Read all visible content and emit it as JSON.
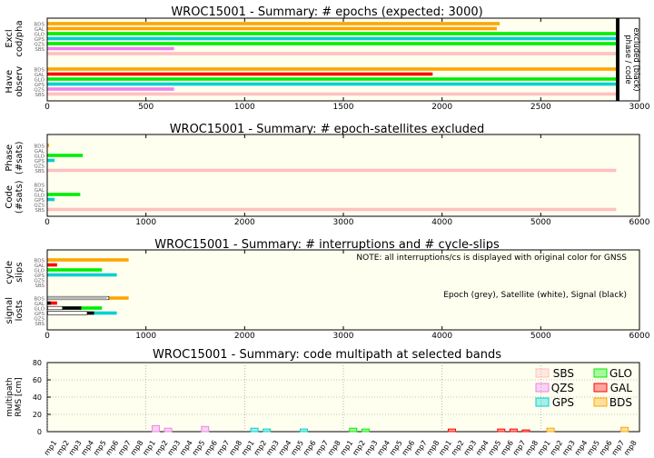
{
  "colors": {
    "plot_bg": "#fffff0",
    "BDS": "#ffa500",
    "GAL": "#ff0000",
    "GLO": "#00ee00",
    "GPS": "#00d0d0",
    "QZS": "#ee82ee",
    "SBS": "#ffc0c0",
    "epoch": "#bbbbbb",
    "satellite": "#ffffff",
    "signal": "#000000",
    "limit": "#000000"
  },
  "chart_data": [
    {
      "type": "bar",
      "orientation": "horizontal",
      "title": "WROC15001 - Summary: # epochs (expected: 3000)",
      "xlim": [
        0,
        3000
      ],
      "xticks": [
        0,
        500,
        1000,
        1500,
        2000,
        2500,
        3000
      ],
      "annotation": [
        "phase / code",
        "excluded (black)"
      ],
      "limit_line_x": 2890,
      "groups": [
        {
          "label": [
            "Excl",
            "cod/pha"
          ],
          "rows": [
            {
              "name": "BDS",
              "values": [
                {
                  "value": 2290,
                  "color": "BDS"
                }
              ]
            },
            {
              "name": "GAL",
              "values": [
                {
                  "value": 2275,
                  "color": "BDS"
                }
              ]
            },
            {
              "name": "GLO",
              "values": [
                {
                  "value": 2880,
                  "color": "GLO"
                }
              ]
            },
            {
              "name": "GPS",
              "values": [
                {
                  "value": 2880,
                  "color": "GPS"
                }
              ]
            },
            {
              "name": "QZS",
              "values": [
                {
                  "value": 2880,
                  "color": "GLO"
                }
              ]
            },
            {
              "name": "SBS",
              "values": [
                {
                  "value": 640,
                  "color": "QZS"
                }
              ]
            },
            {
              "name": "",
              "values": [
                {
                  "value": 2880,
                  "color": "SBS"
                }
              ]
            }
          ]
        },
        {
          "label": [
            "Have",
            "observ"
          ],
          "rows": [
            {
              "name": "BDS",
              "values": [
                {
                  "value": 2880,
                  "color": "BDS"
                }
              ]
            },
            {
              "name": "GAL",
              "values": [
                {
                  "value": 1950,
                  "color": "GAL"
                }
              ]
            },
            {
              "name": "GLO",
              "values": [
                {
                  "value": 2880,
                  "color": "GLO"
                }
              ]
            },
            {
              "name": "GPS",
              "values": [
                {
                  "value": 2880,
                  "color": "GPS"
                }
              ]
            },
            {
              "name": "QZS",
              "values": [
                {
                  "value": 640,
                  "color": "QZS"
                }
              ]
            },
            {
              "name": "SBS",
              "values": [
                {
                  "value": 2880,
                  "color": "SBS"
                }
              ]
            }
          ]
        }
      ]
    },
    {
      "type": "bar",
      "orientation": "horizontal",
      "title": "WROC15001 - Summary: # epoch-satellites excluded",
      "xlim": [
        0,
        6000
      ],
      "xticks": [
        0,
        1000,
        2000,
        3000,
        4000,
        5000,
        6000
      ],
      "groups": [
        {
          "label": [
            "Phase",
            "(#sats)"
          ],
          "rows": [
            {
              "name": "BDS",
              "values": [
                {
                  "value": 15,
                  "color": "BDS"
                }
              ]
            },
            {
              "name": "GAL",
              "values": []
            },
            {
              "name": "GLO",
              "values": [
                {
                  "value": 355,
                  "color": "GLO"
                }
              ]
            },
            {
              "name": "GPS",
              "values": [
                {
                  "value": 70,
                  "color": "GPS"
                }
              ]
            },
            {
              "name": "QZS",
              "values": []
            },
            {
              "name": "SBS",
              "values": [
                {
                  "value": 5760,
                  "color": "SBS"
                }
              ]
            }
          ]
        },
        {
          "label": [
            "Code",
            "(#sats)"
          ],
          "rows": [
            {
              "name": "BDS",
              "values": []
            },
            {
              "name": "GAL",
              "values": []
            },
            {
              "name": "GLO",
              "values": [
                {
                  "value": 330,
                  "color": "GLO"
                }
              ]
            },
            {
              "name": "GPS",
              "values": [
                {
                  "value": 70,
                  "color": "GPS"
                }
              ]
            },
            {
              "name": "QZS",
              "values": []
            },
            {
              "name": "SBS",
              "values": [
                {
                  "value": 5760,
                  "color": "SBS"
                }
              ]
            }
          ]
        }
      ]
    },
    {
      "type": "bar",
      "orientation": "horizontal",
      "title": "WROC15001 - Summary: # interruptions and # cycle-slips",
      "xlim": [
        0,
        6000
      ],
      "xticks": [
        0,
        1000,
        2000,
        3000,
        4000,
        5000,
        6000
      ],
      "notes": [
        "NOTE: all interruptions/cs is displayed with original color for GNSS",
        "Epoch (grey), Satellite (white), Signal (black)"
      ],
      "groups": [
        {
          "label": [
            "cycle",
            "slips"
          ],
          "rows": [
            {
              "name": "BDS",
              "values": [
                {
                  "value": 820,
                  "color": "BDS"
                }
              ]
            },
            {
              "name": "GAL",
              "values": [
                {
                  "value": 95,
                  "color": "GAL"
                }
              ]
            },
            {
              "name": "GLO",
              "values": [
                {
                  "value": 550,
                  "color": "GLO"
                }
              ]
            },
            {
              "name": "GPS",
              "values": [
                {
                  "value": 700,
                  "color": "GPS"
                }
              ]
            },
            {
              "name": "QZS",
              "values": []
            },
            {
              "name": "SBS",
              "values": []
            }
          ]
        },
        {
          "label": [
            "signal",
            "losts"
          ],
          "rows": [
            {
              "name": "BDS",
              "values": [
                {
                  "value": 820,
                  "color": "BDS"
                },
                {
                  "value": 620,
                  "color": "satellite",
                  "outline": true
                },
                {
                  "value": 600,
                  "color": "epoch"
                }
              ]
            },
            {
              "name": "GAL",
              "values": [
                {
                  "value": 95,
                  "color": "GAL"
                },
                {
                  "value": 30,
                  "color": "signal"
                }
              ]
            },
            {
              "name": "GLO",
              "values": [
                {
                  "value": 550,
                  "color": "GLO"
                },
                {
                  "value": 340,
                  "color": "signal"
                },
                {
                  "value": 150,
                  "color": "satellite",
                  "outline": true
                }
              ]
            },
            {
              "name": "GPS",
              "values": [
                {
                  "value": 700,
                  "color": "GPS"
                },
                {
                  "value": 470,
                  "color": "signal"
                },
                {
                  "value": 400,
                  "color": "satellite",
                  "outline": true
                }
              ]
            },
            {
              "name": "QZS",
              "values": []
            },
            {
              "name": "SBS",
              "values": []
            }
          ]
        }
      ]
    },
    {
      "type": "bar",
      "title": "WROC15001 - Summary: code multipath at selected bands",
      "ylabel": [
        "multipath",
        "RMS [cm]"
      ],
      "ylim": [
        0,
        80
      ],
      "yticks": [
        0,
        20,
        40,
        60,
        80
      ],
      "grid": true,
      "legend": {
        "placement": "top-right",
        "entries": [
          {
            "name": "SBS",
            "color": "SBS"
          },
          {
            "name": "GLO",
            "color": "GLO"
          },
          {
            "name": "QZS",
            "color": "QZS"
          },
          {
            "name": "GAL",
            "color": "GAL"
          },
          {
            "name": "GPS",
            "color": "GPS"
          },
          {
            "name": "BDS",
            "color": "BDS"
          }
        ]
      },
      "categories": [
        "mp1",
        "mp2",
        "mp3",
        "mp4",
        "mp5",
        "mp6",
        "mp7",
        "mp8"
      ],
      "series": [
        {
          "name": "SBS",
          "values": [
            0,
            0,
            0,
            0,
            0,
            0,
            0,
            0
          ]
        },
        {
          "name": "QZS",
          "values": [
            7,
            4,
            0,
            0,
            6,
            0,
            0,
            0
          ]
        },
        {
          "name": "GPS",
          "values": [
            4,
            3,
            0,
            0,
            3,
            0,
            0,
            0
          ]
        },
        {
          "name": "GLO",
          "values": [
            4,
            3,
            0,
            0,
            0,
            0,
            0,
            0
          ]
        },
        {
          "name": "GAL",
          "values": [
            3,
            0,
            0,
            0,
            3,
            3,
            2,
            0
          ]
        },
        {
          "name": "BDS",
          "values": [
            4,
            0,
            0,
            0,
            0,
            0,
            5,
            0
          ]
        }
      ]
    }
  ]
}
